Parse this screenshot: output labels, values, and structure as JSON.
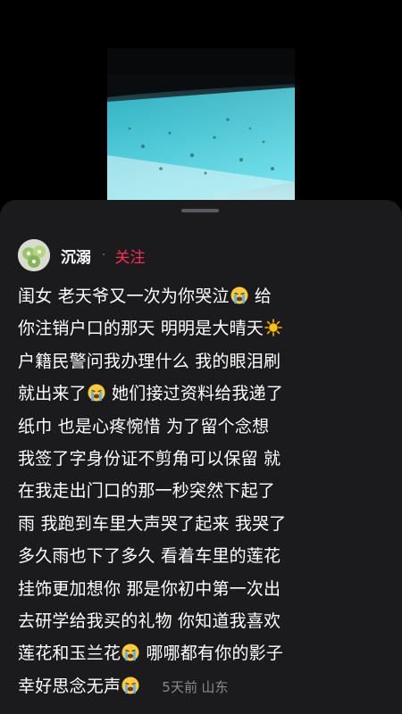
{
  "post": {
    "author": "沉溺",
    "follow_label": "关注",
    "separator": "·",
    "lines": [
      {
        "before": "闺女  老天爷又一次为你哭泣",
        "emoji": "crying-emoji",
        "after": "   给"
      },
      {
        "before": "你注销户口的那天    明明是大晴天",
        "emoji": "sun-emoji",
        "after": ""
      },
      {
        "before": "户籍民警问我办理什么   我的眼泪刷",
        "emoji": "",
        "after": ""
      },
      {
        "before": "就出来了",
        "emoji": "crying-emoji",
        "after": "   她们接过资料给我递了"
      },
      {
        "before": "纸巾   也是心疼惋惜    为了留个念想",
        "emoji": "",
        "after": ""
      },
      {
        "before": "我签了字身份证不剪角可以保留   就",
        "emoji": "",
        "after": ""
      },
      {
        "before": "在我走出门口的那一秒突然下起了",
        "emoji": "",
        "after": ""
      },
      {
        "before": "雨   我跑到车里大声哭了起来   我哭了",
        "emoji": "",
        "after": ""
      },
      {
        "before": "多久雨也下了多久   看着车里的莲花",
        "emoji": "",
        "after": ""
      },
      {
        "before": "挂饰更加想你   那是你初中第一次出",
        "emoji": "",
        "after": ""
      },
      {
        "before": "去研学给我买的礼物   你知道我喜欢",
        "emoji": "",
        "after": ""
      },
      {
        "before": "莲花和玉兰花",
        "emoji": "crying-emoji",
        "after": "    哪哪都有你的影子"
      },
      {
        "before": "幸好思念无声",
        "emoji": "crying-emoji",
        "after": ""
      }
    ],
    "time": "5天前",
    "location": "山东"
  },
  "colors": {
    "accent": "#ff2d55",
    "sheet": "#1b1b1d",
    "muted": "#8a8a8e"
  }
}
